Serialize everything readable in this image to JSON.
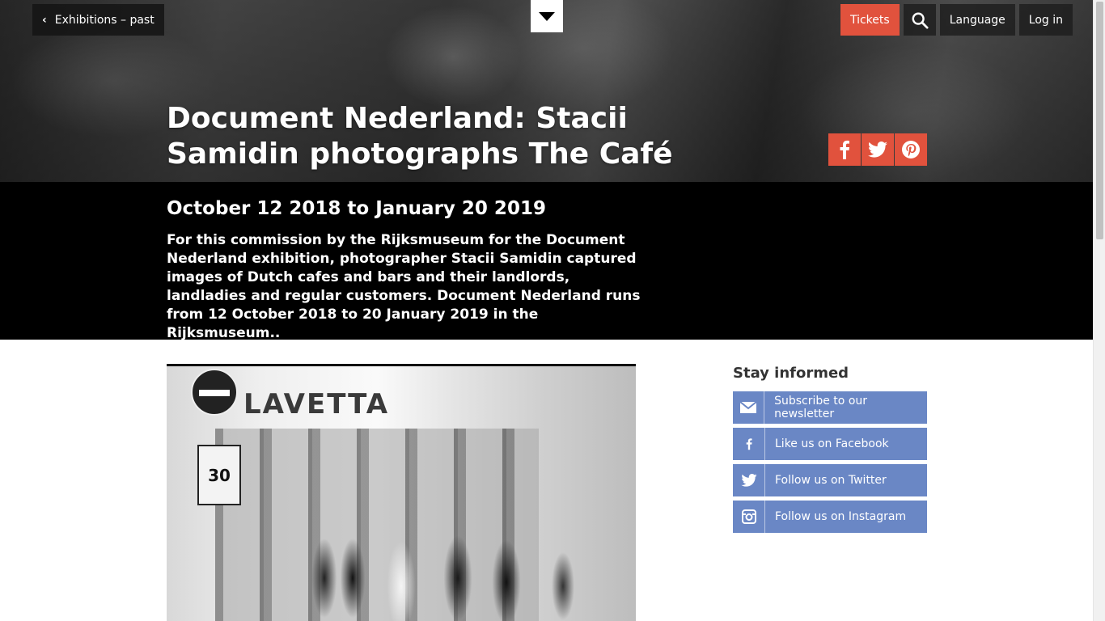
{
  "nav": {
    "back_label": "Exhibitions – past",
    "tickets_label": "Tickets",
    "language_label": "Language",
    "login_label": "Log in"
  },
  "hero": {
    "title": "Document Nederland: Stacii Samidin photographs The Café",
    "share": [
      "facebook-icon",
      "twitter-icon",
      "pinterest-icon"
    ]
  },
  "band": {
    "dates": "October 12 2018 to January 20 2019",
    "description": "For this commission by the Rijksmuseum for the Document Nederland exhibition, photographer Stacii Samidin captured images of Dutch cafes and bars and their landlords, landladies and regular customers. Document Nederland runs from 12 October 2018 to 20 January 2019 in the Rijksmuseum.."
  },
  "photo": {
    "sign_text": "LAVETTA",
    "zone_speed": "30"
  },
  "sidebar": {
    "heading": "Stay informed",
    "items": [
      {
        "label": "Subscribe to our newsletter",
        "icon": "envelope-icon"
      },
      {
        "label": "Like us on Facebook",
        "icon": "facebook-icon"
      },
      {
        "label": "Follow us on Twitter",
        "icon": "twitter-icon"
      },
      {
        "label": "Follow us on Instagram",
        "icon": "instagram-icon"
      }
    ]
  },
  "colors": {
    "accent": "#e1523d",
    "social_blue": "#6a87c5",
    "band": "#000000"
  }
}
